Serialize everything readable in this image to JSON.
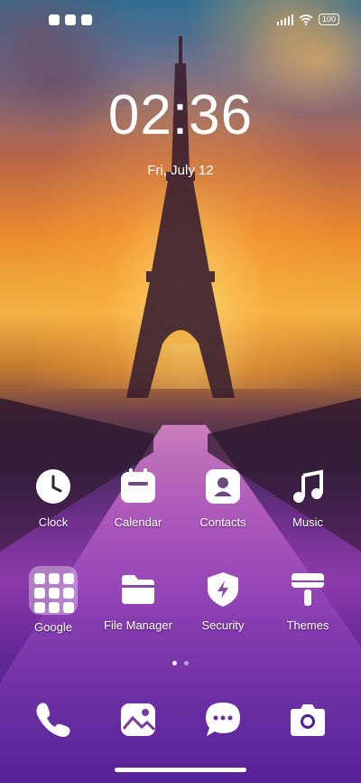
{
  "status_bar": {
    "battery": "100",
    "notif_icons": [
      "app-notification-icon",
      "square-notification-icon",
      "app-notification-icon"
    ],
    "sys_icons": [
      "signal-icon",
      "wifi-icon",
      "battery-icon"
    ]
  },
  "lockscreen": {
    "time": "02:36",
    "date": "Fri, July 12"
  },
  "apps_row1": [
    {
      "label": "Clock",
      "icon": "clock-icon"
    },
    {
      "label": "Calendar",
      "icon": "calendar-icon"
    },
    {
      "label": "Contacts",
      "icon": "contacts-icon"
    },
    {
      "label": "Music",
      "icon": "music-icon"
    }
  ],
  "apps_row2": [
    {
      "label": "Google",
      "icon": "folder-icon"
    },
    {
      "label": "File Manager",
      "icon": "folder-icon"
    },
    {
      "label": "Security",
      "icon": "shield-icon"
    },
    {
      "label": "Themes",
      "icon": "paint-roller-icon"
    }
  ],
  "dock": [
    {
      "icon": "phone-icon"
    },
    {
      "icon": "gallery-icon"
    },
    {
      "icon": "messages-icon"
    },
    {
      "icon": "camera-icon"
    }
  ],
  "page_indicator": {
    "pages": 2,
    "current": 1
  }
}
